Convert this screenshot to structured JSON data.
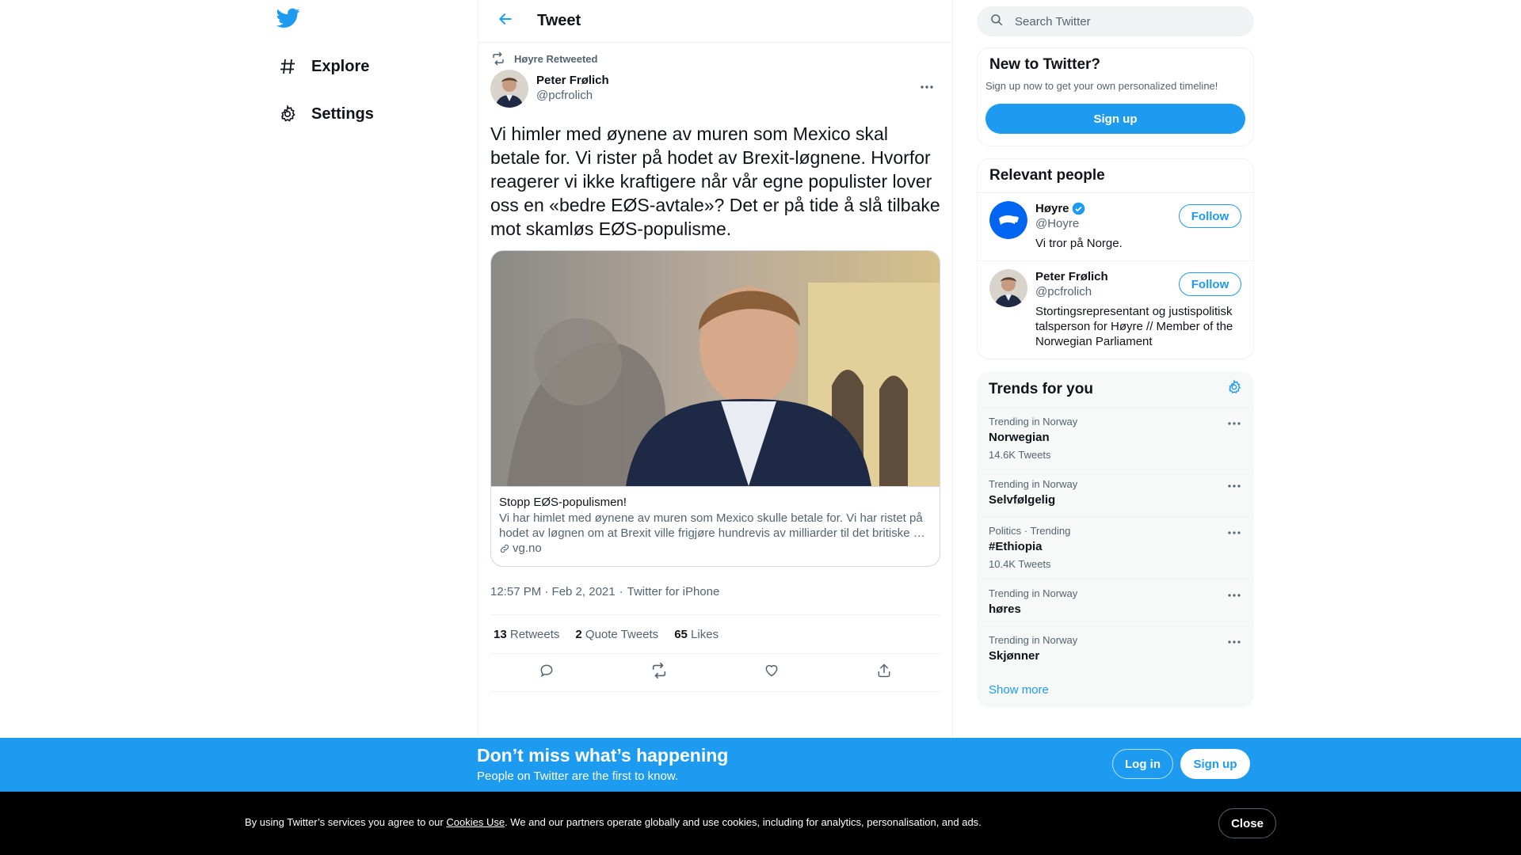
{
  "nav": {
    "logo_icon": "twitter-bird-icon",
    "items": [
      {
        "label": "Explore",
        "icon": "hashtag-icon"
      },
      {
        "label": "Settings",
        "icon": "gear-icon"
      }
    ]
  },
  "header": {
    "title": "Tweet"
  },
  "tweet": {
    "retweeted_by": "Høyre Retweeted",
    "author_name": "Peter Frølich",
    "author_handle": "@pcfrolich",
    "text": "Vi himler med øynene av muren som Mexico skal betale for. Vi rister på hodet av Brexit-løgnene. Hvorfor reagerer vi ikke kraftigere når vår egne populister lover oss en «bedre EØS-avtale»? Det er på tide å slå tilbake mot skamløs EØS-populisme.",
    "card": {
      "title": "Stopp EØS-populismen!",
      "description": "Vi har himlet med øynene av muren som Mexico skulle betale for. Vi har ristet på hodet av løgnen om at Brexit ville frigjøre hundrevis av milliarder til det britiske …",
      "domain": "vg.no"
    },
    "time": "12:57 PM · Feb 2, 2021",
    "time_separator": "·",
    "source": "Twitter for iPhone",
    "stats": {
      "retweets_count": "13",
      "retweets_label": "Retweets",
      "quotes_count": "2",
      "quotes_label": "Quote Tweets",
      "likes_count": "65",
      "likes_label": "Likes"
    }
  },
  "right": {
    "search_placeholder": "Search Twitter",
    "signup_panel": {
      "title": "New to Twitter?",
      "subtitle": "Sign up now to get your own personalized timeline!",
      "button": "Sign up"
    },
    "relevant": {
      "title": "Relevant people",
      "people": [
        {
          "name": "Høyre",
          "handle": "@Hoyre",
          "bio": "Vi tror på Norge.",
          "follow": "Follow",
          "verified": true
        },
        {
          "name": "Peter Frølich",
          "handle": "@pcfrolich",
          "bio": "Stortingsrepresentant og justispolitisk talsperson for Høyre // Member of the Norwegian Parliament",
          "follow": "Follow",
          "verified": false
        }
      ]
    },
    "trends": {
      "title": "Trends for you",
      "items": [
        {
          "context": "Trending in Norway",
          "name": "Norwegian",
          "count": "14.6K Tweets"
        },
        {
          "context": "Trending in Norway",
          "name": "Selvfølgelig",
          "count": ""
        },
        {
          "context": "Politics · Trending",
          "name": "#Ethiopia",
          "count": "10.4K Tweets"
        },
        {
          "context": "Trending in Norway",
          "name": "høres",
          "count": ""
        },
        {
          "context": "Trending in Norway",
          "name": "Skjønner",
          "count": ""
        }
      ],
      "show_more": "Show more"
    }
  },
  "banner": {
    "title": "Don’t miss what’s happening",
    "subtitle": "People on Twitter are the first to know.",
    "login": "Log in",
    "signup": "Sign up"
  },
  "cookies": {
    "text_before": "By using Twitter’s services you agree to our ",
    "link": "Cookies Use",
    "text_after": ". We and our partners operate globally and use cookies, including for analytics, personalisation, and ads.",
    "close": "Close"
  },
  "colors": {
    "accent": "#1d9bf0",
    "text": "#0f1419",
    "muted": "#536471",
    "border": "#eff3f4"
  }
}
